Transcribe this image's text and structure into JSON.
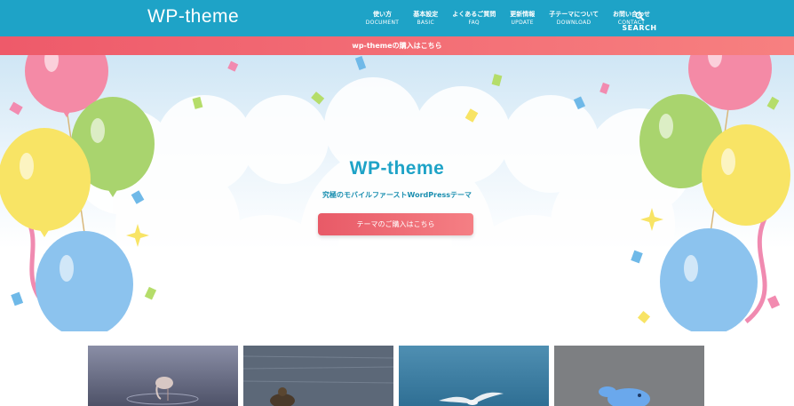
{
  "header": {
    "logo": "WP-theme",
    "nav": [
      {
        "jp": "使い方",
        "en": "DOCUMENT"
      },
      {
        "jp": "基本設定",
        "en": "BASIC"
      },
      {
        "jp": "よくあるご質問",
        "en": "FAQ"
      },
      {
        "jp": "更新情報",
        "en": "UPDATE"
      },
      {
        "jp": "子テーマについて",
        "en": "DOWNLOAD"
      },
      {
        "jp": "お問い合わせ",
        "en": "CONTACT"
      }
    ],
    "search_label": "SEARCH"
  },
  "promo": {
    "text": "wp-themeの購入はこちら"
  },
  "hero": {
    "title": "WP-theme",
    "subtitle": "究極のモバイルファーストWordPressテーマ",
    "button": "テーマのご購入はこちら"
  },
  "cards": [
    {
      "image": "flamingo-photo"
    },
    {
      "image": "duck-photo"
    },
    {
      "image": "seagull-photo"
    },
    {
      "image": "blue-toy-photo"
    }
  ],
  "colors": {
    "header": "#1ea3c7",
    "accent": "#ee5a6a"
  }
}
